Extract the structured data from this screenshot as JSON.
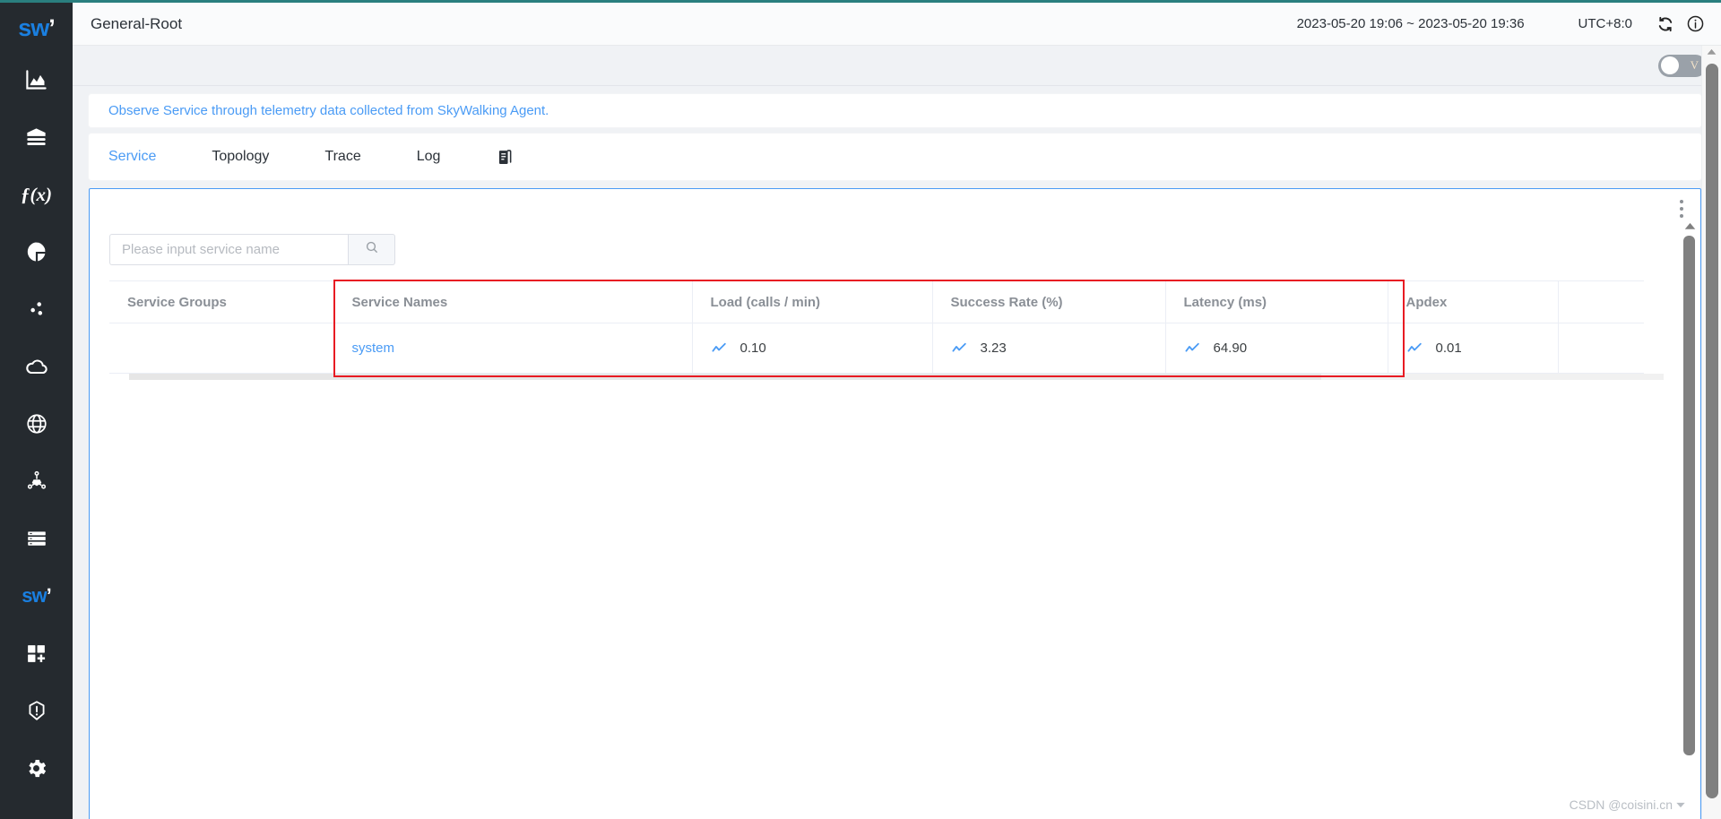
{
  "colors": {
    "accent": "#4a9bf5",
    "brand_dark": "#252a2f",
    "teal_top": "#2a7f7f",
    "highlight": "#e81b23",
    "link": "#4a9bf5"
  },
  "sidebar": {
    "logo": {
      "text": "sw",
      "name": "skywalking-logo"
    },
    "items": [
      {
        "icon": "dashboard-chart-icon",
        "label": "Dashboard"
      },
      {
        "icon": "database-layers-icon",
        "label": "Database"
      },
      {
        "icon": "function-fx-icon",
        "label": "Functions"
      },
      {
        "icon": "pie-chart-icon",
        "label": "Metrics"
      },
      {
        "icon": "scatter-dots-icon",
        "label": "Scatter"
      },
      {
        "icon": "cloud-icon",
        "label": "Cloud"
      },
      {
        "icon": "globe-icon",
        "label": "Network"
      },
      {
        "icon": "topology-node-icon",
        "label": "Topology"
      },
      {
        "icon": "server-list-icon",
        "label": "Servers"
      },
      {
        "icon": "skywalking-logo-icon",
        "label": "SkyWalking"
      },
      {
        "icon": "grid-plus-icon",
        "label": "Add Dashboard"
      },
      {
        "icon": "alarm-hexagon-icon",
        "label": "Alarm"
      },
      {
        "icon": "settings-gear-icon",
        "label": "Settings"
      }
    ]
  },
  "header": {
    "title": "General-Root",
    "time_range": "2023-05-20 19:06 ~ 2023-05-20 19:36",
    "timezone": "UTC+8:0",
    "refresh_icon": "refresh-icon",
    "info_icon": "info-circle-icon"
  },
  "toggle": {
    "label": "V",
    "state": "off"
  },
  "banner": {
    "text": "Observe Service through telemetry data collected from SkyWalking Agent."
  },
  "tabs": [
    {
      "label": "Service",
      "active": true
    },
    {
      "label": "Topology",
      "active": false
    },
    {
      "label": "Trace",
      "active": false
    },
    {
      "label": "Log",
      "active": false
    }
  ],
  "tabs_extra_icon": "copy-document-icon",
  "panel": {
    "kebab_icon": "more-vertical-icon",
    "search": {
      "placeholder": "Please input service name",
      "value": "",
      "button_icon": "search-icon"
    },
    "table": {
      "columns": [
        "Service Groups",
        "Service Names",
        "Load (calls / min)",
        "Success Rate (%)",
        "Latency (ms)",
        "Apdex",
        ""
      ],
      "rows": [
        {
          "service_group": "",
          "service_name": "system",
          "load": "0.10",
          "success_rate": "3.23",
          "latency": "64.90",
          "apdex": "0.01",
          "extra": ""
        }
      ],
      "trend_icon": "trend-line-icon"
    }
  },
  "watermark": {
    "text": "CSDN @coisini.cn"
  }
}
